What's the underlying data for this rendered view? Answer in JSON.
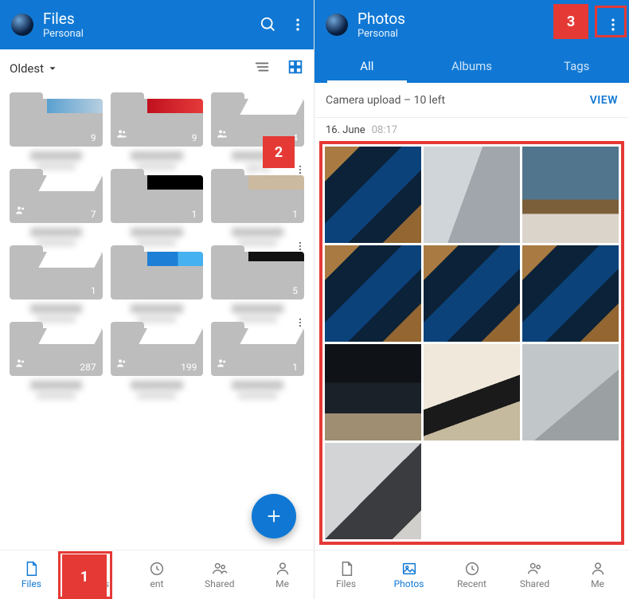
{
  "callouts": {
    "one": "1",
    "two": "2",
    "three": "3"
  },
  "left": {
    "header": {
      "title": "Files",
      "subtitle": "Personal"
    },
    "sort": {
      "label": "Oldest"
    },
    "folders": [
      {
        "count": "9",
        "shared": false,
        "accent": "photo"
      },
      {
        "count": "9",
        "shared": true,
        "accent": "red"
      },
      {
        "count": "4",
        "shared": true,
        "accent": ""
      },
      {
        "count": "7",
        "shared": true,
        "accent": ""
      },
      {
        "count": "1",
        "shared": false,
        "accent": "dark"
      },
      {
        "count": "1",
        "shared": false,
        "accent": "beige"
      },
      {
        "count": "1",
        "shared": false,
        "accent": ""
      },
      {
        "count": "",
        "shared": false,
        "accent": "blue"
      },
      {
        "count": "5",
        "shared": false,
        "accent": "darkbar"
      },
      {
        "count": "287",
        "shared": true,
        "accent": ""
      },
      {
        "count": "199",
        "shared": true,
        "accent": ""
      },
      {
        "count": "1",
        "shared": true,
        "accent": ""
      }
    ],
    "folder_label_hint": "2016",
    "nav": {
      "files": "Files",
      "photos": "Photos",
      "recent": "ent",
      "shared": "Shared",
      "me": "Me"
    }
  },
  "right": {
    "header": {
      "title": "Photos",
      "subtitle": "Personal"
    },
    "tabs": {
      "all": "All",
      "albums": "Albums",
      "tags": "Tags"
    },
    "upload": {
      "text": "Camera upload – 10 left",
      "action": "VIEW"
    },
    "date": {
      "day": "16. June",
      "time": "08:17"
    },
    "nav": {
      "files": "Files",
      "photos": "Photos",
      "recent": "Recent",
      "shared": "Shared",
      "me": "Me"
    }
  }
}
